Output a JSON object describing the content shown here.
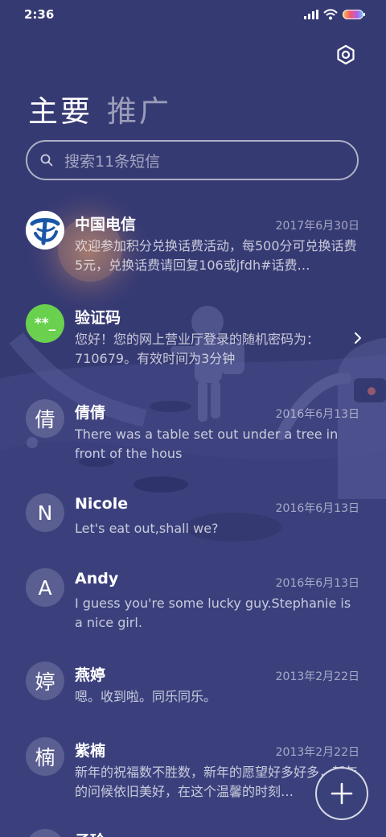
{
  "status_bar": {
    "time": "2:36"
  },
  "tabs": {
    "primary": "主要",
    "promotions": "推广"
  },
  "search": {
    "placeholder": "搜索11条短信"
  },
  "messages": [
    {
      "sender": "中国电信",
      "date": "2017年6月30日",
      "preview": "欢迎参加积分兑换话费活动，每500分可兑换话费5元，兑换话费请回复106或jfdh#话费…",
      "avatar": "china-telecom-logo"
    },
    {
      "sender": "验证码",
      "date": "",
      "preview": "您好！您的网上营业厅登录的随机密码为：710679。有效时间为3分钟",
      "avatar_text": "**_"
    },
    {
      "sender": "倩倩",
      "date": "2016年6月13日",
      "preview": "There was a table set out under a tree in front of the hous",
      "avatar_text": "倩"
    },
    {
      "sender": "Nicole",
      "date": "2016年6月13日",
      "preview": "Let's eat out,shall we?",
      "avatar_text": "N"
    },
    {
      "sender": "Andy",
      "date": "2016年6月13日",
      "preview": "I guess you're some lucky guy.Stephanie is a nice girl.",
      "avatar_text": "A"
    },
    {
      "sender": "燕婷",
      "date": "2013年2月22日",
      "preview": "嗯。收到啦。同乐同乐。",
      "avatar_text": "婷"
    },
    {
      "sender": "紫楠",
      "date": "2013年2月22日",
      "preview": "新年的祝福数不胜数，新年的愿望好多好多，新年的问候依旧美好，在这个温馨的时刻…",
      "avatar_text": "楠"
    },
    {
      "sender": "子玲",
      "avatar_text": ""
    }
  ],
  "colors": {
    "background": "#363a73",
    "verification_avatar": "#6ad14f",
    "telecom_blue": "#1a56a8"
  },
  "icons": {
    "settings": "gear-icon",
    "search": "search-icon",
    "compose": "plus-icon",
    "chevron": "chevron-right-icon"
  }
}
